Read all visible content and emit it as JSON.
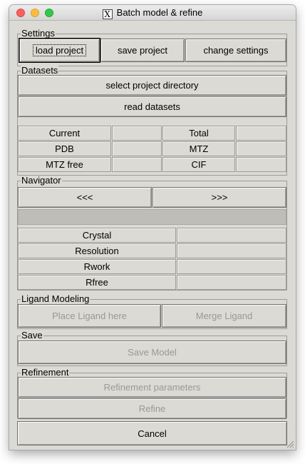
{
  "window": {
    "title": "Batch model & refine"
  },
  "settings": {
    "label": "Settings",
    "load_project": "load project",
    "save_project": "save project",
    "change_settings": "change settings"
  },
  "datasets": {
    "label": "Datasets",
    "select_project_directory": "select project directory",
    "read_datasets": "read datasets",
    "grid": [
      [
        "Current",
        "",
        "Total",
        ""
      ],
      [
        "PDB",
        "",
        "MTZ",
        ""
      ],
      [
        "MTZ free",
        "",
        "CIF",
        ""
      ]
    ]
  },
  "navigator": {
    "label": "Navigator",
    "prev": "<<<",
    "next": ">>>",
    "status": "",
    "stats": [
      [
        "Crystal",
        ""
      ],
      [
        "Resolution",
        ""
      ],
      [
        "Rwork",
        ""
      ],
      [
        "Rfree",
        ""
      ]
    ]
  },
  "ligand": {
    "label": "Ligand Modeling",
    "place_ligand": "Place Ligand here",
    "merge_ligand": "Merge Ligand"
  },
  "save": {
    "label": "Save",
    "save_model": "Save Model"
  },
  "refinement": {
    "label": "Refinement",
    "parameters": "Refinement parameters",
    "refine": "Refine"
  },
  "cancel": "Cancel"
}
